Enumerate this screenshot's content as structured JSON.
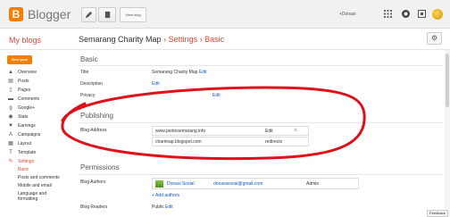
{
  "topbar": {
    "logo_letter": "B",
    "logo_text": "Blogger",
    "view_blog_label": "View blog",
    "user_label": "+Donasi",
    "icons": [
      "pencil-icon",
      "pages-icon",
      "apps-grid-icon",
      "notifications-icon",
      "share-icon",
      "avatar"
    ]
  },
  "header": {
    "my_blogs": "My blogs",
    "blog_name": "Semarang Charity Map",
    "sep1": "›",
    "settings": "Settings",
    "sep2": "›",
    "current": "Basic",
    "gear": "⚙"
  },
  "sidebar": {
    "new_post": "New post",
    "items": [
      {
        "label": "Overview",
        "icon": "▲"
      },
      {
        "label": "Posts",
        "icon": "▤"
      },
      {
        "label": "Pages",
        "icon": "▯"
      },
      {
        "label": "Comments",
        "icon": "▬"
      },
      {
        "label": "Google+",
        "icon": "g"
      },
      {
        "label": "Stats",
        "icon": "◉"
      },
      {
        "label": "Earnings",
        "icon": "▼"
      },
      {
        "label": "Campaigns",
        "icon": "A"
      },
      {
        "label": "Layout",
        "icon": "▦"
      },
      {
        "label": "Template",
        "icon": "T"
      },
      {
        "label": "Settings",
        "icon": "✎"
      }
    ],
    "sub_items": [
      "Basic",
      "Posts and comments",
      "Mobile and email",
      "Language and",
      "formatting"
    ]
  },
  "basic": {
    "heading": "Basic",
    "title_label": "Title",
    "title_value": "Semarang Charity Map",
    "edit": "Edit",
    "description_label": "Description",
    "privacy_label": "Privacy"
  },
  "publishing": {
    "heading": "Publishing",
    "blog_address_label": "Blog Address",
    "primary_address": "www.peritosemarang.info",
    "secondary_address": "charimap.blogspot.com",
    "redirects": "redirects",
    "close": "×"
  },
  "permissions": {
    "heading": "Permissions",
    "authors_label": "Blog Authors",
    "author_name": "Donasi Sosial",
    "author_email": "donasisosial@gmail.com",
    "author_role": "Admin",
    "add_authors": "+ Add authors",
    "readers_label": "Blog Readers",
    "readers_value": "Public"
  },
  "feedback": "Feedback",
  "colors": {
    "accent": "#dd4b39",
    "brand": "#f57d00",
    "link": "#1155cc",
    "annotation": "#e0101a"
  }
}
